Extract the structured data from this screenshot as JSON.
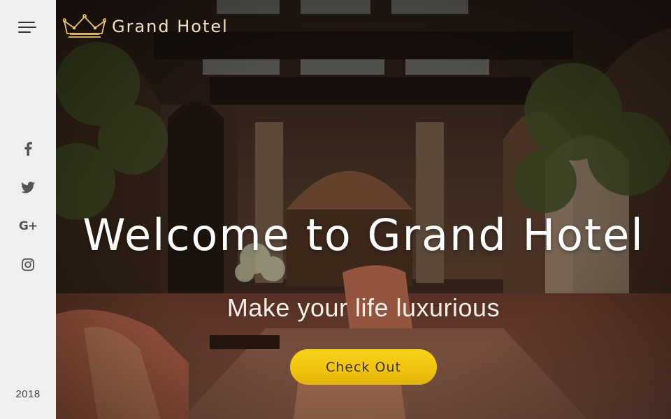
{
  "brand": {
    "name": "Grand Hotel",
    "logo_icon": "crown-icon"
  },
  "sidebar": {
    "menu_icon": "hamburger-menu-icon",
    "social": [
      {
        "name": "facebook",
        "icon": "facebook-icon"
      },
      {
        "name": "twitter",
        "icon": "twitter-icon"
      },
      {
        "name": "google-plus",
        "icon": "google-plus-icon",
        "glyph": "G+"
      },
      {
        "name": "instagram",
        "icon": "instagram-icon"
      }
    ],
    "year": "2018"
  },
  "hero": {
    "title": "Welcome to Grand Hotel",
    "subtitle": "Make your life luxurious",
    "cta_label": "Check Out"
  },
  "colors": {
    "accent": "#f5c915",
    "sidebar_bg": "#efefef",
    "brand_text": "#f2e2c4",
    "icon_gray": "#555555"
  }
}
